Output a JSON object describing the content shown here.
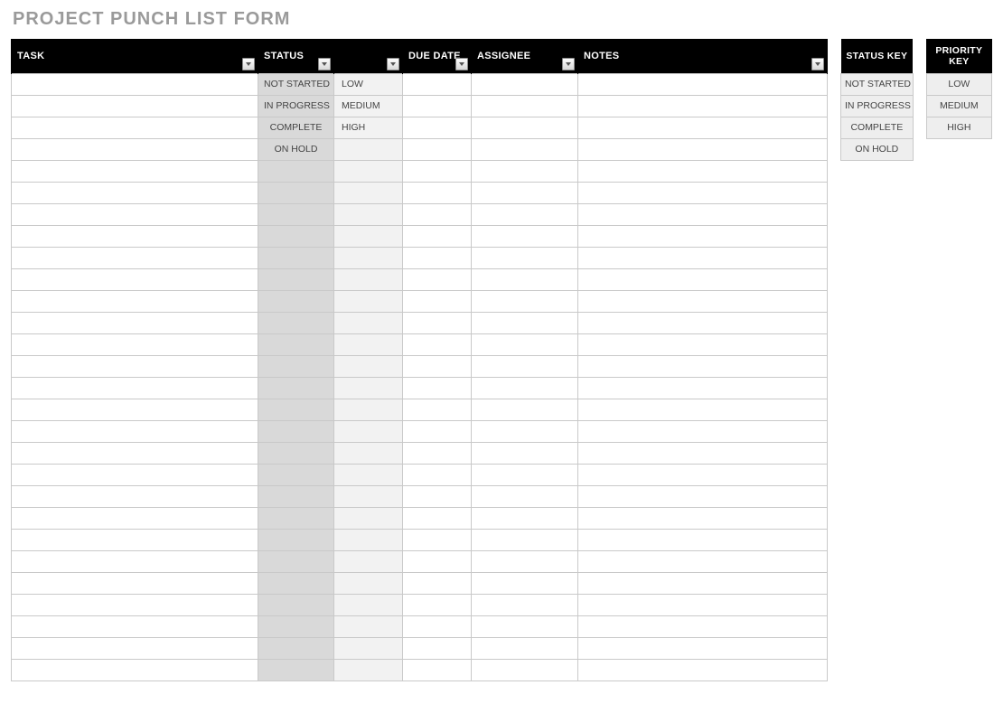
{
  "title": "PROJECT PUNCH LIST FORM",
  "columns": {
    "task": "TASK",
    "status": "STATUS",
    "priority": "",
    "due_date": "DUE DATE",
    "assignee": "ASSIGNEE",
    "notes": "NOTES"
  },
  "rows": [
    {
      "task": "",
      "status": "NOT STARTED",
      "priority": "LOW",
      "due_date": "",
      "assignee": "",
      "notes": ""
    },
    {
      "task": "",
      "status": "IN PROGRESS",
      "priority": "MEDIUM",
      "due_date": "",
      "assignee": "",
      "notes": ""
    },
    {
      "task": "",
      "status": "COMPLETE",
      "priority": "HIGH",
      "due_date": "",
      "assignee": "",
      "notes": ""
    },
    {
      "task": "",
      "status": "ON HOLD",
      "priority": "",
      "due_date": "",
      "assignee": "",
      "notes": ""
    },
    {
      "task": "",
      "status": "",
      "priority": "",
      "due_date": "",
      "assignee": "",
      "notes": ""
    },
    {
      "task": "",
      "status": "",
      "priority": "",
      "due_date": "",
      "assignee": "",
      "notes": ""
    },
    {
      "task": "",
      "status": "",
      "priority": "",
      "due_date": "",
      "assignee": "",
      "notes": ""
    },
    {
      "task": "",
      "status": "",
      "priority": "",
      "due_date": "",
      "assignee": "",
      "notes": ""
    },
    {
      "task": "",
      "status": "",
      "priority": "",
      "due_date": "",
      "assignee": "",
      "notes": ""
    },
    {
      "task": "",
      "status": "",
      "priority": "",
      "due_date": "",
      "assignee": "",
      "notes": ""
    },
    {
      "task": "",
      "status": "",
      "priority": "",
      "due_date": "",
      "assignee": "",
      "notes": ""
    },
    {
      "task": "",
      "status": "",
      "priority": "",
      "due_date": "",
      "assignee": "",
      "notes": ""
    },
    {
      "task": "",
      "status": "",
      "priority": "",
      "due_date": "",
      "assignee": "",
      "notes": ""
    },
    {
      "task": "",
      "status": "",
      "priority": "",
      "due_date": "",
      "assignee": "",
      "notes": ""
    },
    {
      "task": "",
      "status": "",
      "priority": "",
      "due_date": "",
      "assignee": "",
      "notes": ""
    },
    {
      "task": "",
      "status": "",
      "priority": "",
      "due_date": "",
      "assignee": "",
      "notes": ""
    },
    {
      "task": "",
      "status": "",
      "priority": "",
      "due_date": "",
      "assignee": "",
      "notes": ""
    },
    {
      "task": "",
      "status": "",
      "priority": "",
      "due_date": "",
      "assignee": "",
      "notes": ""
    },
    {
      "task": "",
      "status": "",
      "priority": "",
      "due_date": "",
      "assignee": "",
      "notes": ""
    },
    {
      "task": "",
      "status": "",
      "priority": "",
      "due_date": "",
      "assignee": "",
      "notes": ""
    },
    {
      "task": "",
      "status": "",
      "priority": "",
      "due_date": "",
      "assignee": "",
      "notes": ""
    },
    {
      "task": "",
      "status": "",
      "priority": "",
      "due_date": "",
      "assignee": "",
      "notes": ""
    },
    {
      "task": "",
      "status": "",
      "priority": "",
      "due_date": "",
      "assignee": "",
      "notes": ""
    },
    {
      "task": "",
      "status": "",
      "priority": "",
      "due_date": "",
      "assignee": "",
      "notes": ""
    },
    {
      "task": "",
      "status": "",
      "priority": "",
      "due_date": "",
      "assignee": "",
      "notes": ""
    },
    {
      "task": "",
      "status": "",
      "priority": "",
      "due_date": "",
      "assignee": "",
      "notes": ""
    },
    {
      "task": "",
      "status": "",
      "priority": "",
      "due_date": "",
      "assignee": "",
      "notes": ""
    },
    {
      "task": "",
      "status": "",
      "priority": "",
      "due_date": "",
      "assignee": "",
      "notes": ""
    }
  ],
  "status_key": {
    "header": "STATUS KEY",
    "items": [
      "NOT STARTED",
      "IN PROGRESS",
      "COMPLETE",
      "ON HOLD"
    ]
  },
  "priority_key": {
    "header": "PRIORITY KEY",
    "items": [
      "LOW",
      "MEDIUM",
      "HIGH"
    ]
  }
}
